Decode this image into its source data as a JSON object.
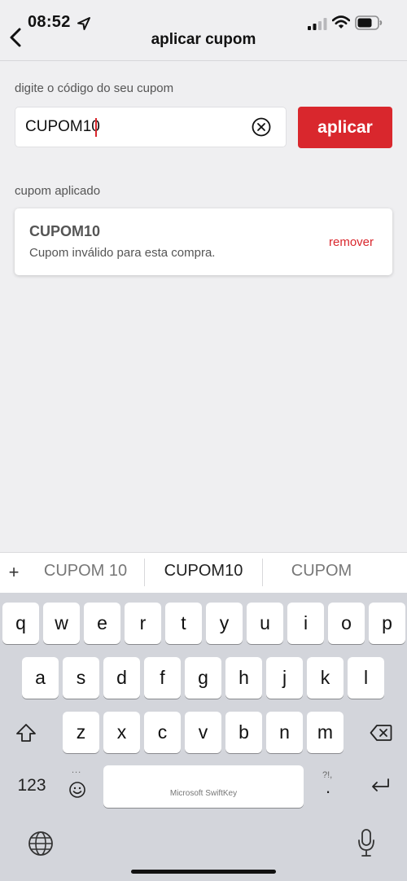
{
  "status_bar": {
    "time": "08:52",
    "location_icon": "location-arrow-icon",
    "signal_icon": "cellular-signal-icon",
    "wifi_icon": "wifi-icon",
    "battery_icon": "battery-icon"
  },
  "header": {
    "title": "aplicar cupom",
    "back_icon": "chevron-left-icon"
  },
  "coupon_form": {
    "label": "digite o código do seu cupom",
    "input_value": "CUPOM10",
    "clear_icon": "circle-x-icon",
    "apply_label": "aplicar"
  },
  "applied_coupon": {
    "section_label": "cupom aplicado",
    "code": "CUPOM10",
    "message": "Cupom inválido para esta compra.",
    "remove_label": "remover"
  },
  "colors": {
    "accent": "#d9272d",
    "background": "#efeff1",
    "keyboard": "#d3d5db"
  },
  "keyboard": {
    "suggestions": [
      "CUPOM 10",
      "CUPOM10",
      "CUPOM"
    ],
    "plus": "+",
    "row1": [
      "q",
      "w",
      "e",
      "r",
      "t",
      "y",
      "u",
      "i",
      "o",
      "p"
    ],
    "row2": [
      "a",
      "s",
      "d",
      "f",
      "g",
      "h",
      "j",
      "k",
      "l"
    ],
    "row3": [
      "z",
      "x",
      "c",
      "v",
      "b",
      "n",
      "m"
    ],
    "numbers_label": "123",
    "space_label": "Microsoft SwiftKey",
    "punct_hint": "?!,",
    "punct_label": ".",
    "emoji_hint": "...",
    "icons": [
      "shift-icon",
      "backspace-icon",
      "emoji-icon",
      "return-icon",
      "globe-icon",
      "microphone-icon"
    ]
  }
}
